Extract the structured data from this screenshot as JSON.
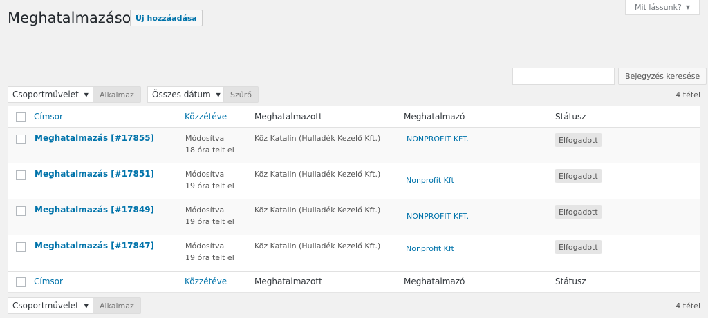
{
  "screen_options": {
    "label": "Mit lássunk?"
  },
  "page": {
    "title": "Meghatalmazások",
    "add_new": "Új hozzáadása"
  },
  "search": {
    "placeholder": "",
    "button": "Bejegyzés keresése"
  },
  "toolbar_top": {
    "bulk_action": "Csoportművelet",
    "apply": "Alkalmaz",
    "date_filter": "Összes dátum",
    "filter": "Szűrő",
    "count": "4 tétel"
  },
  "toolbar_bottom": {
    "bulk_action": "Csoportművelet",
    "apply": "Alkalmaz",
    "count": "4 tétel"
  },
  "columns": {
    "title": "Címsor",
    "date": "Közzétéve",
    "agent": "Meghatalmazott",
    "principal": "Meghatalmazó",
    "status": "Státusz"
  },
  "rows": [
    {
      "title": "Meghatalmazás [#17855]",
      "date_status": "Módosítva",
      "date_ago": "18 óra telt el",
      "agent": "Köz Katalin (Hulladék Kezelő Kft.)",
      "principal": "NONPROFIT KFT.",
      "status": "Elfogadott"
    },
    {
      "title": "Meghatalmazás [#17851]",
      "date_status": "Módosítva",
      "date_ago": "19 óra telt el",
      "agent": "Köz Katalin (Hulladék Kezelő Kft.)",
      "principal": "Nonprofit Kft",
      "status": "Elfogadott"
    },
    {
      "title": "Meghatalmazás [#17849]",
      "date_status": "Módosítva",
      "date_ago": "19 óra telt el",
      "agent": "Köz Katalin (Hulladék Kezelő Kft.)",
      "principal": "NONPROFIT KFT.",
      "status": "Elfogadott"
    },
    {
      "title": "Meghatalmazás [#17847]",
      "date_status": "Módosítva",
      "date_ago": "19 óra telt el",
      "agent": "Köz Katalin (Hulladék Kezelő Kft.)",
      "principal": "Nonprofit Kft",
      "status": "Elfogadott"
    }
  ]
}
